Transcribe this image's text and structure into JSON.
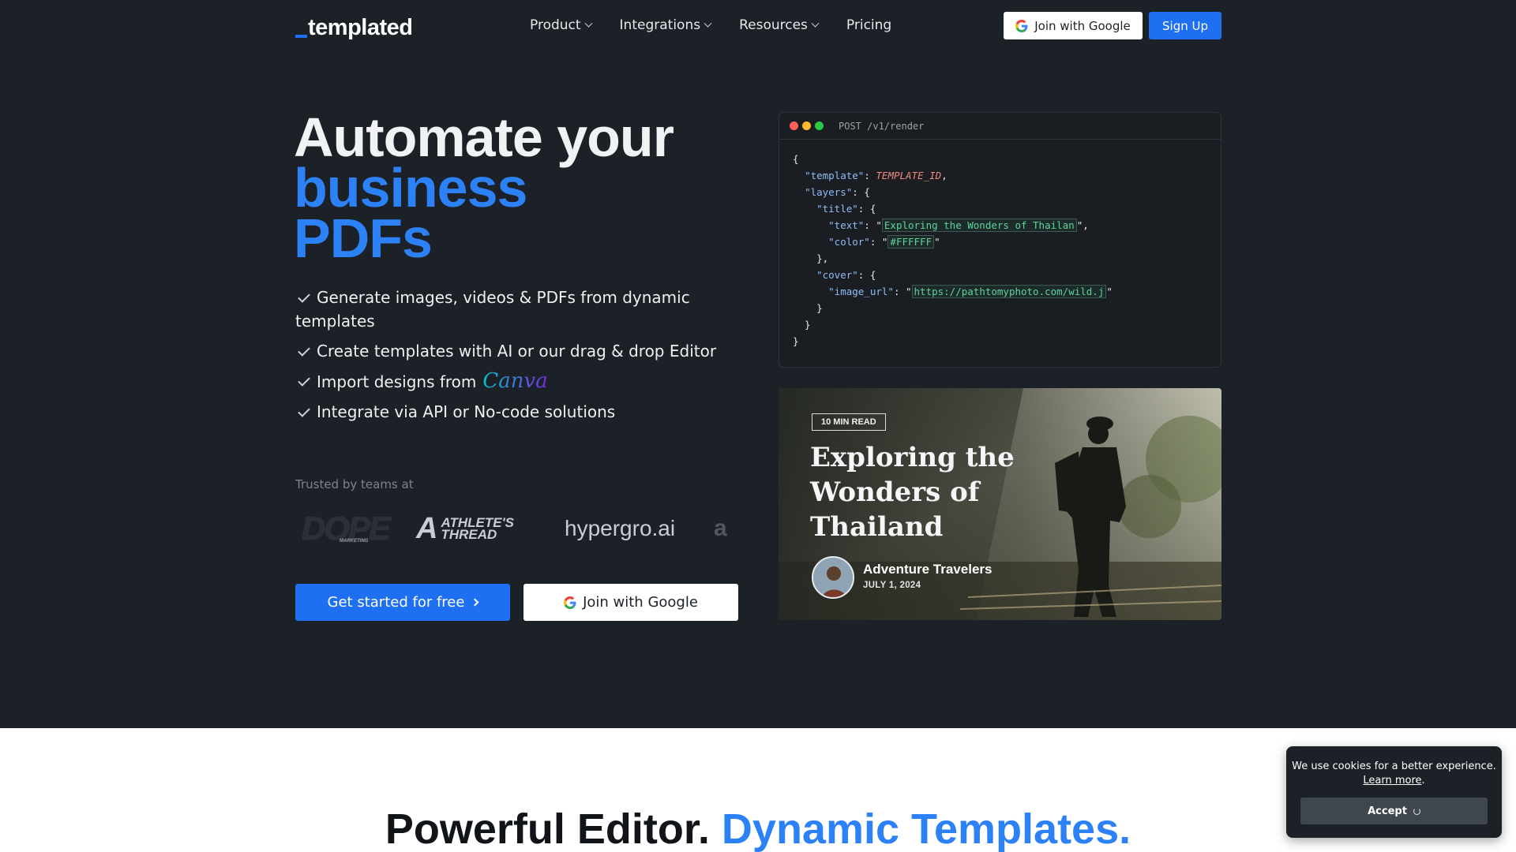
{
  "nav": {
    "logo": "templated",
    "items": [
      {
        "label": "Product",
        "has_menu": true
      },
      {
        "label": "Integrations",
        "has_menu": true
      },
      {
        "label": "Resources",
        "has_menu": true
      },
      {
        "label": "Pricing",
        "has_menu": false
      }
    ],
    "join_google": "Join with Google",
    "sign_up": "Sign Up"
  },
  "hero": {
    "headline_line1": "Automate your",
    "headline_line2": "business",
    "headline_line3": "PDFs",
    "features": [
      "Generate images, videos & PDFs from dynamic templates",
      "Create templates with AI or our drag & drop Editor",
      "Import designs from",
      "Integrate via API or No-code solutions"
    ],
    "canva_word": "Canva",
    "trusted_label": "Trusted by teams at",
    "logos": {
      "dope": "DOPE",
      "dope_sub": "MARKETING",
      "athletes_line1": "ATHLETE'S",
      "athletes_line2": "THREAD",
      "athletes_mark": "A",
      "hypergro": "hypergro.ai",
      "partial": "a"
    },
    "cta_primary": "Get started for free",
    "cta_google": "Join with Google"
  },
  "code_panel": {
    "method": "POST /v1/render",
    "template_key": "\"template\"",
    "template_value": "TEMPLATE_ID",
    "layers_key": "\"layers\"",
    "title_key": "\"title\"",
    "text_key": "\"text\"",
    "text_value": "Exploring the Wonders of Thailan",
    "color_key": "\"color\"",
    "color_value": "#FFFFFF",
    "cover_key": "\"cover\"",
    "image_url_key": "\"image_url\"",
    "image_url_value": "https://pathtomyphoto.com/wild.j"
  },
  "blog_card": {
    "badge": "10 MIN READ",
    "title": "Exploring the Wonders of Thailand",
    "author": "Adventure Travelers",
    "date": "JULY 1, 2024"
  },
  "section2": {
    "heading_dark": "Powerful Editor.",
    "heading_blue": "Dynamic Templates."
  },
  "cookie": {
    "message": "We use cookies for a better experience.",
    "learn_more": "Learn more",
    "accept": "Accept"
  },
  "colors": {
    "hero_bg": "#1c2127",
    "accent_blue": "#1e6ff2",
    "headline_blue": "#2d81f7"
  }
}
